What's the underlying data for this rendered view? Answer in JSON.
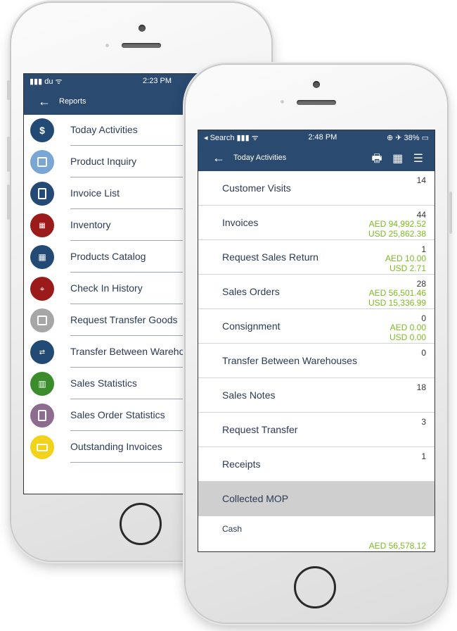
{
  "back_phone": {
    "status": {
      "carrier": "du",
      "time": "2:23 PM"
    },
    "nav": {
      "title": "Reports"
    },
    "items": [
      {
        "label": "Today Activities",
        "color": "#234a75",
        "icon": "money-icon"
      },
      {
        "label": "Product Inquiry",
        "color": "#7aa6d6",
        "icon": "box-icon"
      },
      {
        "label": "Invoice List",
        "color": "#234a75",
        "icon": "invoice-icon"
      },
      {
        "label": "Inventory",
        "color": "#9b1b1b",
        "icon": "warehouse-icon"
      },
      {
        "label": "Products Catalog",
        "color": "#234a75",
        "icon": "grid-icon"
      },
      {
        "label": "Check In History",
        "color": "#9b1b1b",
        "icon": "map-icon"
      },
      {
        "label": "Request Transfer Goods",
        "color": "#a6a6a6",
        "icon": "transfer-icon"
      },
      {
        "label": "Transfer Between Wareho",
        "color": "#234a75",
        "icon": "warehouses-icon"
      },
      {
        "label": "Sales Statistics",
        "color": "#3a8d2a",
        "icon": "chart-icon"
      },
      {
        "label": "Sales Order Statistics",
        "color": "#8d6c8f",
        "icon": "document-icon"
      },
      {
        "label": "Outstanding Invoices",
        "color": "#f2d21a",
        "icon": "briefcase-icon"
      }
    ]
  },
  "front_phone": {
    "status": {
      "left": "Search",
      "time": "2:48 PM",
      "battery": "38%"
    },
    "nav": {
      "title": "Today Activities"
    },
    "rows": [
      {
        "label": "Customer Visits",
        "count": "14",
        "aed": "",
        "usd": ""
      },
      {
        "label": "Invoices",
        "count": "44",
        "aed": "AED 94,992.52",
        "usd": "USD 25,862.38"
      },
      {
        "label": "Request Sales Return",
        "count": "1",
        "aed": "AED 10.00",
        "usd": "USD 2.71"
      },
      {
        "label": "Sales Orders",
        "count": "28",
        "aed": "AED 56,501.46",
        "usd": "USD 15,336.99"
      },
      {
        "label": "Consignment",
        "count": "0",
        "aed": "AED 0.00",
        "usd": "USD 0.00"
      },
      {
        "label": "Transfer Between Warehouses",
        "count": "0",
        "aed": "",
        "usd": ""
      },
      {
        "label": "Sales Notes",
        "count": "18",
        "aed": "",
        "usd": ""
      },
      {
        "label": "Request Transfer",
        "count": "3",
        "aed": "",
        "usd": ""
      },
      {
        "label": "Receipts",
        "count": "1",
        "aed": "",
        "usd": ""
      }
    ],
    "section": {
      "label": "Collected MOP"
    },
    "cash": {
      "label": "Cash",
      "amount": "AED 56,578.12"
    }
  },
  "colors": {
    "navbar": "#2b4a70",
    "green": "#7cbb21",
    "section_bg": "#cfcfcf"
  }
}
